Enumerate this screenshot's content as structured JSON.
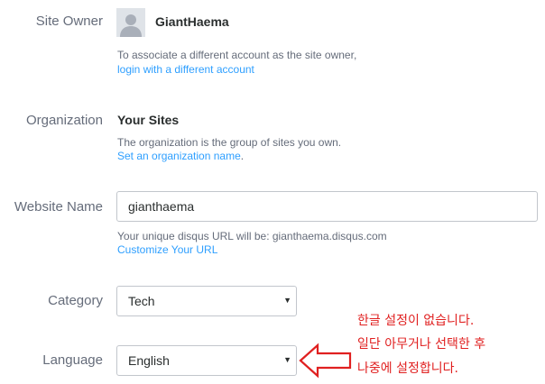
{
  "site_owner": {
    "label": "Site Owner",
    "username": "GiantHaema",
    "help_text": "To associate a different account as the site owner,",
    "link_text": "login with a different account"
  },
  "organization": {
    "label": "Organization",
    "value": "Your Sites",
    "help_text": "The organization is the group of sites you own.",
    "link_text": "Set an organization name",
    "link_suffix": "."
  },
  "website_name": {
    "label": "Website Name",
    "value": "gianthaema",
    "help_text": "Your unique disqus URL will be: gianthaema.disqus.com",
    "link_text": "Customize Your URL"
  },
  "category": {
    "label": "Category",
    "selected": "Tech"
  },
  "language": {
    "label": "Language",
    "selected": "English"
  },
  "annotation": {
    "lines": [
      "한글 설정이 없습니다.",
      "일단 아무거나 선택한 후",
      "나중에 설정합니다."
    ],
    "color": "#e02020"
  },
  "colors": {
    "label": "#656c7a",
    "link": "#2e9fff",
    "text": "#2a2e2e",
    "border": "#c2c6cc"
  },
  "icons": {
    "avatar": "default-user-avatar-icon",
    "select_caret": "caret-down-icon",
    "annotation_arrow": "left-arrow-outline-icon"
  }
}
